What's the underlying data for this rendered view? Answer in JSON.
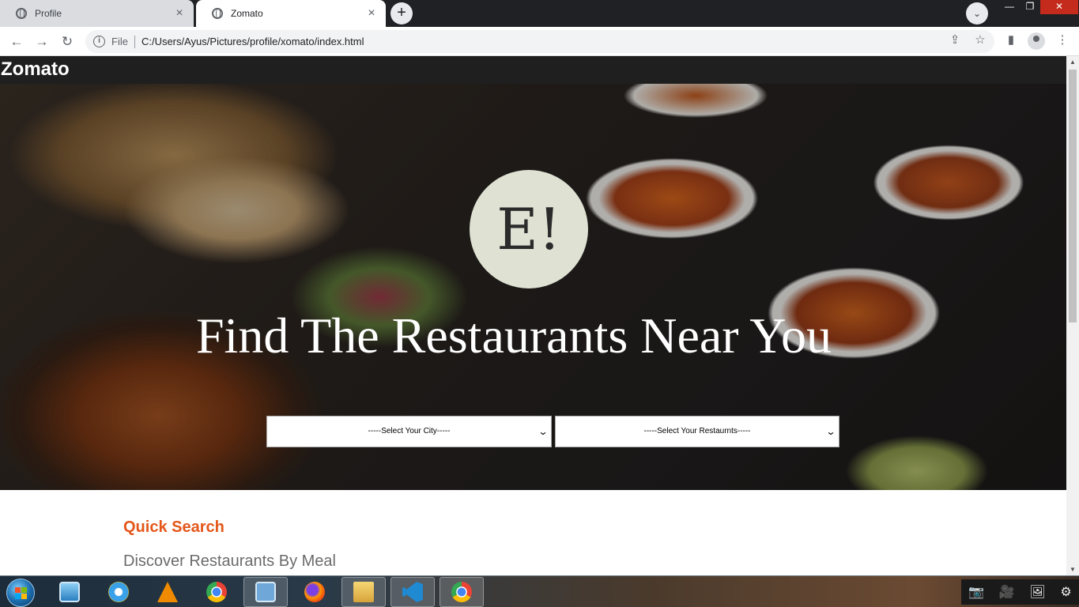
{
  "browser": {
    "tabs": [
      {
        "title": "Profile",
        "active": false
      },
      {
        "title": "Zomato",
        "active": true
      }
    ],
    "url_scheme_label": "File",
    "url": "C:/Users/Ayus/Pictures/profile/xomato/index.html"
  },
  "site": {
    "brand": "Zomato",
    "logo_text": "E!",
    "hero_title": "Find The Restaurants Near You",
    "city_select": {
      "selected": "-----Select Your City-----"
    },
    "restaurant_select": {
      "selected": "-----Select Your Restaurnts-----"
    },
    "quick_search_heading": "Quick Search",
    "discover_subheading": "Discover Restaurants By Meal"
  },
  "colors": {
    "header_bg": "#1f1f1f",
    "accent": "#e4561a",
    "logo_circle": "#dfe2d3",
    "subheading": "#6b6b6b"
  },
  "taskbar": {
    "apps": [
      "media-player",
      "internet-explorer",
      "vlc",
      "chrome",
      "control-panel",
      "firefox",
      "file-explorer",
      "vscode",
      "chrome-profile"
    ]
  }
}
